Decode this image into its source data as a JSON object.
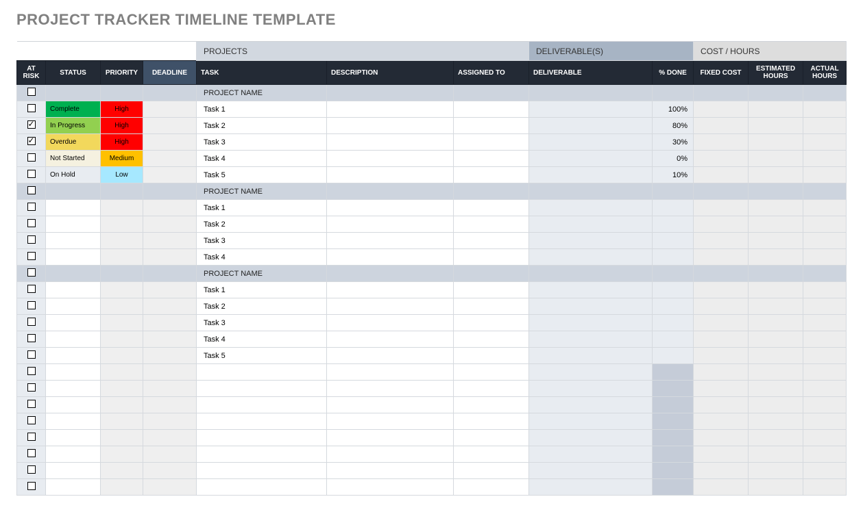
{
  "title": "PROJECT TRACKER TIMELINE TEMPLATE",
  "sections": {
    "projects": "PROJECTS",
    "deliverables": "DELIVERABLE(S)",
    "cost": "COST / HOURS"
  },
  "headers": {
    "risk": "AT RISK",
    "status": "STATUS",
    "priority": "PRIORITY",
    "deadline": "DEADLINE",
    "task": "TASK",
    "description": "DESCRIPTION",
    "assigned": "ASSIGNED TO",
    "deliverable": "DELIVERABLE",
    "done": "% DONE",
    "fixed": "FIXED COST",
    "est": "ESTIMATED HOURS",
    "act": "ACTUAL HOURS"
  },
  "status_colors": {
    "Complete": "st-complete",
    "In Progress": "st-inprogress",
    "Overdue": "st-overdue",
    "Not Started": "st-notstarted",
    "On Hold": "st-onhold"
  },
  "priority_colors": {
    "High": "pr-high",
    "Medium": "pr-medium",
    "Low": "pr-low"
  },
  "rows": [
    {
      "type": "project",
      "task": "PROJECT NAME"
    },
    {
      "type": "task",
      "checked": false,
      "status": "Complete",
      "priority": "High",
      "task": "Task 1",
      "done": "100%"
    },
    {
      "type": "task",
      "checked": true,
      "status": "In Progress",
      "priority": "High",
      "task": "Task 2",
      "done": "80%"
    },
    {
      "type": "task",
      "checked": true,
      "status": "Overdue",
      "priority": "High",
      "task": "Task 3",
      "done": "30%"
    },
    {
      "type": "task",
      "checked": false,
      "status": "Not Started",
      "priority": "Medium",
      "task": "Task 4",
      "done": "0%"
    },
    {
      "type": "task",
      "checked": false,
      "status": "On Hold",
      "priority": "Low",
      "task": "Task 5",
      "done": "10%"
    },
    {
      "type": "project",
      "task": "PROJECT NAME"
    },
    {
      "type": "task",
      "checked": false,
      "task": "Task 1"
    },
    {
      "type": "task",
      "checked": false,
      "task": "Task 2"
    },
    {
      "type": "task",
      "checked": false,
      "task": "Task 3"
    },
    {
      "type": "task",
      "checked": false,
      "task": "Task 4"
    },
    {
      "type": "project",
      "task": "PROJECT NAME"
    },
    {
      "type": "task",
      "checked": false,
      "task": "Task 1"
    },
    {
      "type": "task",
      "checked": false,
      "task": "Task 2"
    },
    {
      "type": "task",
      "checked": false,
      "task": "Task 3"
    },
    {
      "type": "task",
      "checked": false,
      "task": "Task 4"
    },
    {
      "type": "task",
      "checked": false,
      "task": "Task 5"
    },
    {
      "type": "blank",
      "checked": false
    },
    {
      "type": "blank",
      "checked": false
    },
    {
      "type": "blank",
      "checked": false
    },
    {
      "type": "blank",
      "checked": false
    },
    {
      "type": "blank",
      "checked": false
    },
    {
      "type": "blank",
      "checked": false
    },
    {
      "type": "blank",
      "checked": false
    },
    {
      "type": "blank",
      "checked": false
    }
  ]
}
